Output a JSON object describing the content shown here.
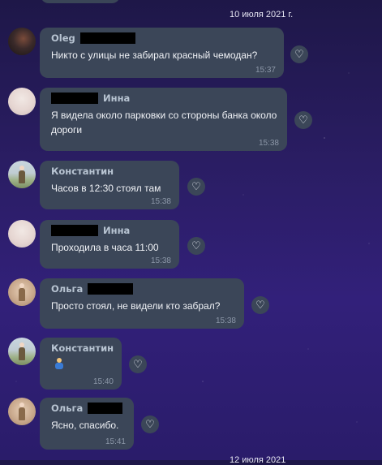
{
  "dates": {
    "first": "10 июля 2021 г.",
    "bottom_partial": "12 июля 2021"
  },
  "icons": {
    "like": "heart-icon"
  },
  "messages": [
    {
      "author": "Oleg",
      "text": "Никто с улицы не забирал красный чемодан?",
      "time": "15:37",
      "avatar": "oleg"
    },
    {
      "author": "Инна",
      "text": "Я видела около парковки со стороны банка около дороги",
      "time": "15:38",
      "avatar": "inna"
    },
    {
      "author": "Константин",
      "text": "Часов в 12:30 стоял там",
      "time": "15:38",
      "avatar": "konstantin"
    },
    {
      "author": "Инна",
      "text": "Проходила в часа 11:00",
      "time": "15:38",
      "avatar": "inna"
    },
    {
      "author": "Ольга",
      "text": "Просто стоял, не видели кто забрал?",
      "time": "15:38",
      "avatar": "olga"
    },
    {
      "author": "Константин",
      "text": "🤷",
      "time": "15:40",
      "avatar": "konstantin"
    },
    {
      "author": "Ольга",
      "text": "Ясно, спасибо.",
      "time": "15:41",
      "avatar": "olga"
    }
  ]
}
